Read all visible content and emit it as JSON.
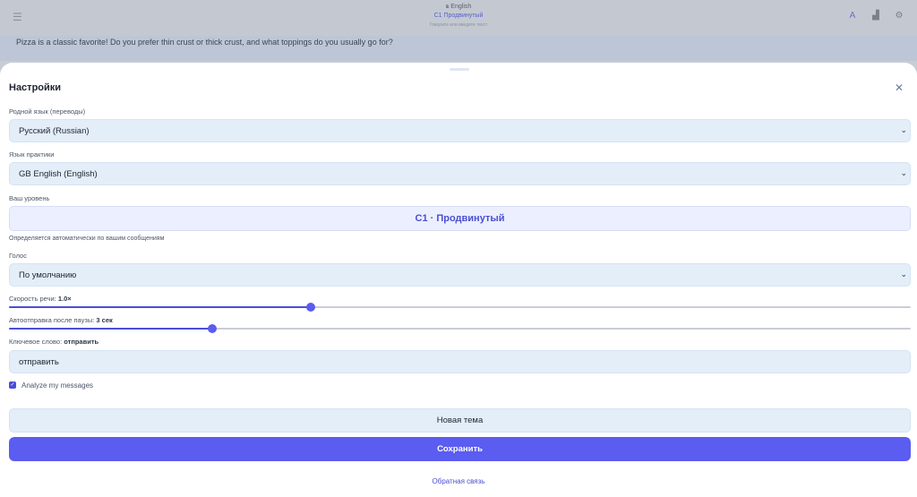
{
  "background": {
    "header_title": "ҩ English",
    "header_subtitle": "C1 Продвинутый",
    "header_note": "Говорите или введите текст",
    "message": "Pizza is a classic favorite! Do you prefer thin crust or thick crust, and what toppings do you usually go for?"
  },
  "sheet": {
    "title": "Настройки",
    "native_label": "Родной язык (переводы)",
    "native_value": "Русский (Russian)",
    "practice_label": "Язык практики",
    "practice_value": "GB English (English)",
    "level_label": "Ваш уровень",
    "level_value": "C1 · Продвинутый",
    "level_hint": "Определяется автоматически по вашим сообщениям",
    "voice_label": "Голос",
    "voice_value": "По умолчанию",
    "speed_label": "Скорость речи:",
    "speed_value": "1.0×",
    "speed_fraction": 0.335,
    "autosend_label": "Автоотправка после паузы:",
    "autosend_value": "3 сек",
    "autosend_fraction": 0.225,
    "keyword_label": "Ключевое слово:",
    "keyword_value": "отправить",
    "keyword_input": "отправить",
    "analyze_label": "Analyze my messages",
    "analyze_checked": true,
    "new_topic_label": "Новая тема",
    "save_label": "Сохранить",
    "feedback_label": "Обратная связь"
  },
  "colors": {
    "accent": "#5b5cf0",
    "field_bg": "#e3eef9",
    "level_text": "#4a4fd0"
  }
}
